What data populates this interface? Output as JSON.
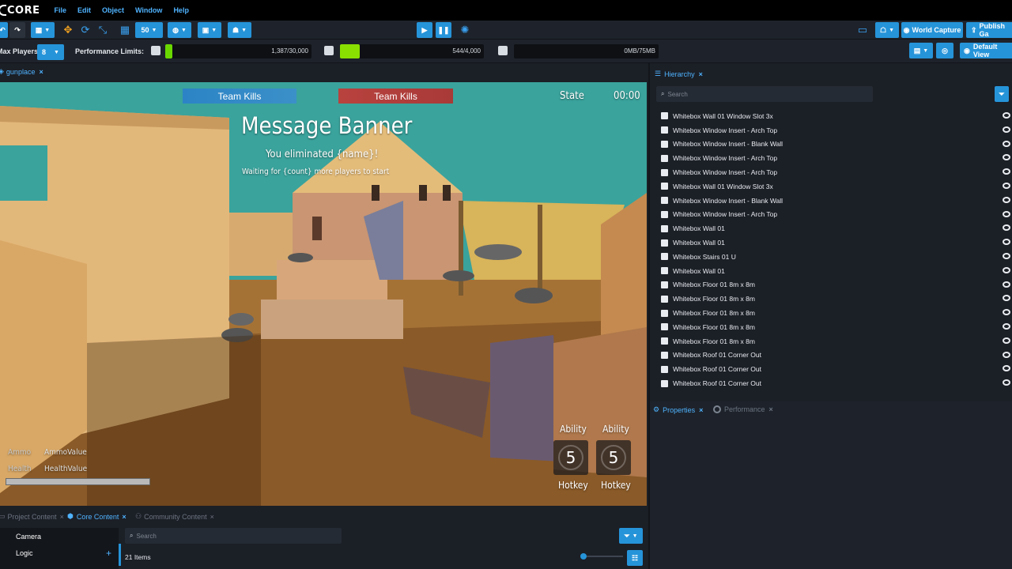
{
  "menubar": {
    "logo_text": "CORE",
    "items": [
      "File",
      "Edit",
      "Object",
      "Window",
      "Help"
    ]
  },
  "toolbar": {
    "grid_size": "50",
    "world_capture": "World Capture",
    "publish": "Publish Ga"
  },
  "perf": {
    "max_players_label": "Max Players",
    "max_players_value": "8",
    "limits_label": "Performance Limits:",
    "gauge1": "1,387/30,000",
    "gauge1_fraction": 0.046,
    "gauge2": "544/4,000",
    "gauge2_fraction": 0.136,
    "gauge3": "0MB/75MB",
    "gauge3_fraction": 0.0,
    "default_view": "Default View"
  },
  "viewport": {
    "tab_label": "gunplace",
    "team_kills_left": "Team Kills",
    "team_kills_right": "Team Kills",
    "state_label": "State",
    "timer": "00:00",
    "banner_title": "Message Banner",
    "banner_line1": "You eliminated {name}!",
    "banner_line2": "Waiting for {count} more players to start",
    "ammo_label": "Ammo",
    "ammo_value": "AmmoValue",
    "health_label": "Health",
    "health_value": "HealthValue",
    "ability1_label": "Ability",
    "ability1_count": "5",
    "ability1_hotkey": "Hotkey",
    "ability2_label": "Ability",
    "ability2_count": "5",
    "ability2_hotkey": "Hotkey",
    "colors": {
      "team_blue": "#2f7fc0",
      "team_red": "#b0403e"
    }
  },
  "hierarchy": {
    "tab_label": "Hierarchy",
    "search_placeholder": "Search",
    "items": [
      "Whitebox Wall 01 Window Slot 3x",
      "Whitebox Window Insert - Arch Top",
      "Whitebox Window Insert - Blank Wall",
      "Whitebox Window Insert - Arch Top",
      "Whitebox Window Insert - Arch Top",
      "Whitebox Wall 01 Window Slot 3x",
      "Whitebox Window Insert - Blank Wall",
      "Whitebox Window Insert - Arch Top",
      "Whitebox Wall 01",
      "Whitebox Wall 01",
      "Whitebox Stairs 01 U",
      "Whitebox Wall 01",
      "Whitebox Floor 01 8m x 8m",
      "Whitebox Floor 01 8m x 8m",
      "Whitebox Floor 01 8m x 8m",
      "Whitebox Floor 01 8m x 8m",
      "Whitebox Floor 01 8m x 8m",
      "Whitebox Roof 01 Corner Out",
      "Whitebox Roof 01 Corner Out",
      "Whitebox Roof 01 Corner Out"
    ]
  },
  "properties": {
    "tab_properties": "Properties",
    "tab_performance": "Performance"
  },
  "content": {
    "tab_project": "Project Content",
    "tab_core": "Core Content",
    "tab_community": "Community Content",
    "search_placeholder": "Search",
    "categories": [
      "Camera",
      "Logic"
    ],
    "item_count": "21 Items"
  }
}
